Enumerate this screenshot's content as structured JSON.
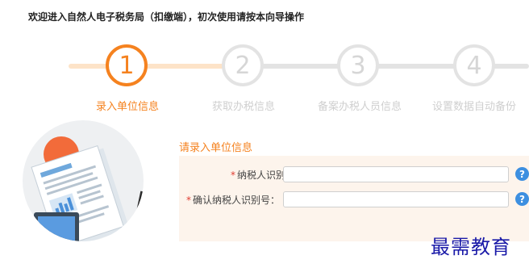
{
  "header": {
    "welcome_text": "欢迎进入自然人电子税务局（扣缴端），初次使用请按本向导操作"
  },
  "wizard": {
    "active_step": 1,
    "steps": [
      {
        "number": "1",
        "label": "录入单位信息",
        "state": "active"
      },
      {
        "number": "2",
        "label": "获取办税信息",
        "state": "inactive"
      },
      {
        "number": "3",
        "label": "备案办税人员信息",
        "state": "inactive"
      },
      {
        "number": "4",
        "label": "设置数据自动备份",
        "state": "inactive"
      }
    ]
  },
  "form": {
    "title": "请录入单位信息",
    "fields": [
      {
        "required_mark": "*",
        "label": "纳税人识别号：",
        "value": "",
        "help": "?"
      },
      {
        "required_mark": "*",
        "label": "确认纳税人识别号：",
        "value": "",
        "help": "?"
      }
    ]
  },
  "watermark": "最需教育",
  "colors": {
    "accent": "#f5821f",
    "inactive_step": "#e3e3e3",
    "form_background": "#fdf4ec",
    "help_icon": "#3d8fe0",
    "required": "#e03c31",
    "watermark": "#1a1aa8"
  }
}
